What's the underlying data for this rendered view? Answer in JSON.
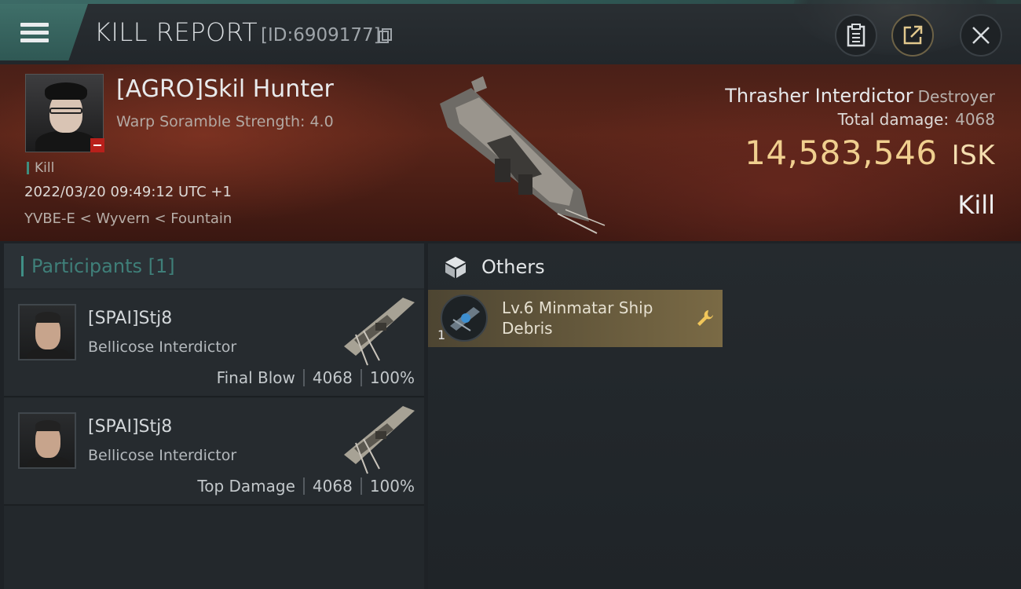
{
  "header": {
    "title": "KILL REPORT",
    "report_id": "[ID:6909177]"
  },
  "victim": {
    "name": "[AGRO]Skil Hunter",
    "warp_scramble": "Warp Soramble Strength: 4.0",
    "tag": "Kill",
    "datetime": "2022/03/20 09:49:12 UTC +1",
    "location": "YVBE-E < Wyvern < Fountain",
    "ship_name": "Thrasher Interdictor",
    "ship_class": "Destroyer",
    "total_damage_label": "Total damage:",
    "total_damage_value": "4068",
    "isk_value": "14,583,546",
    "isk_unit": "ISK",
    "result": "Kill"
  },
  "participants": {
    "title": "Participants [1]",
    "items": [
      {
        "name": "[SPAI]Stj8",
        "ship": "Bellicose Interdictor",
        "role": "Final Blow",
        "damage": "4068",
        "percent": "100%"
      },
      {
        "name": "[SPAI]Stj8",
        "ship": "Bellicose Interdictor",
        "role": "Top Damage",
        "damage": "4068",
        "percent": "100%"
      }
    ]
  },
  "others": {
    "title": "Others",
    "items": [
      {
        "qty": "1",
        "name": "Lv.6 Minmatar Ship Debris"
      }
    ]
  },
  "colors": {
    "accent_teal": "#3f8f86",
    "isk_gold": "#f0cf8f",
    "item_gold": "#7a6a45",
    "loss_red": "#b8201b"
  },
  "icons": [
    "menu-icon",
    "copy-icon",
    "clipboard-icon",
    "share-icon",
    "close-icon",
    "cube-icon",
    "wrench-icon"
  ]
}
